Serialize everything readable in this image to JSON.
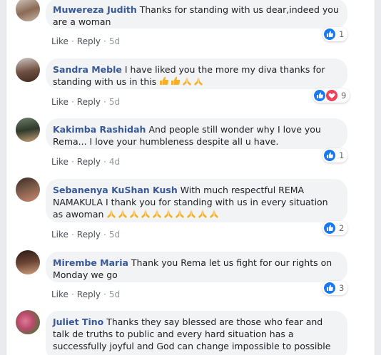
{
  "comments": [
    {
      "name": "Muwereza Judith",
      "text": "Thanks for standing with us dear,indeed you are a woman",
      "like": "Like",
      "reply": "Reply",
      "time": "5d",
      "reactions": [
        "like"
      ],
      "reaction_count": "1"
    },
    {
      "name": "Sandra Meble",
      "text": "I have liked you the more my diva thanks for standing with us in this",
      "emojis": [
        "thumbs-up",
        "thumbs-up",
        "pray",
        "pray"
      ],
      "like": "Like",
      "reply": "Reply",
      "time": "5d",
      "reactions": [
        "like",
        "love"
      ],
      "reaction_count": "9"
    },
    {
      "name": "Kakimba Rashidah",
      "text": "And people still wonder why I love you Rema... I love your humbleness despite all u have.",
      "like": "Like",
      "reply": "Reply",
      "time": "4d",
      "reactions": [
        "like"
      ],
      "reaction_count": "1"
    },
    {
      "name": "Sebanenya KuShan Kush",
      "text": "With much respectful REMA NAMAKULA I thank you for standing with us in every situation as awoman",
      "emojis": [
        "pray",
        "pray",
        "pray",
        "pray",
        "pray",
        "pray",
        "pray",
        "pray",
        "pray",
        "pray"
      ],
      "like": "Like",
      "reply": "Reply",
      "time": "5d",
      "reactions": [
        "like"
      ],
      "reaction_count": "2"
    },
    {
      "name": "Mirembe Maria",
      "text": "Thank you Rema let us fight for our rights on Monday we go",
      "like": "Like",
      "reply": "Reply",
      "time": "5d",
      "reactions": [
        "like"
      ],
      "reaction_count": "3"
    },
    {
      "name": "Juliet Tino",
      "text": "Thanks they say blessed are those who fear and talk de truths to public and every hard situation has a successfully joyful and God can change impossible to possible",
      "like": "",
      "reply": "",
      "time": "",
      "reactions": [],
      "reaction_count": ""
    }
  ],
  "colors": {
    "name": "#385898",
    "like_blue": "#1877f2",
    "love_red": "#f33e58",
    "bubble": "#f2f3f5"
  }
}
